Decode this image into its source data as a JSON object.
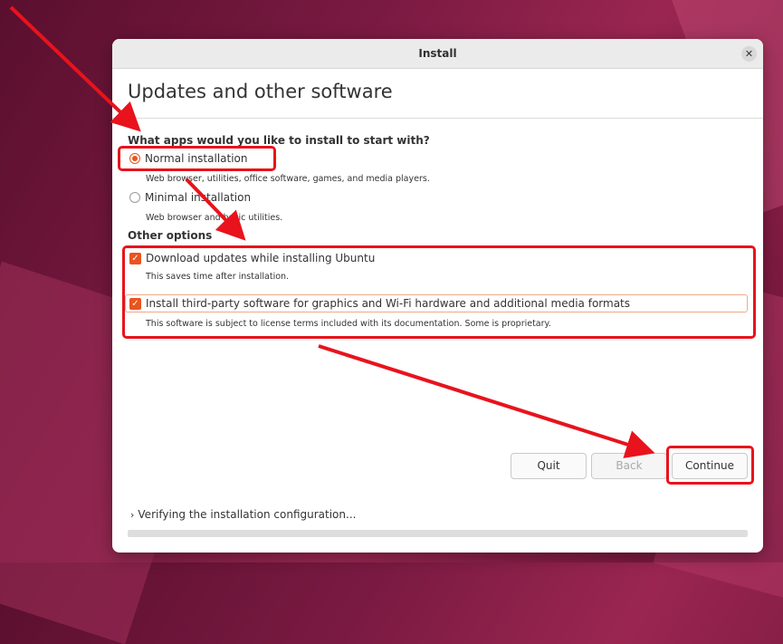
{
  "window": {
    "title": "Install",
    "close_icon": "close-icon",
    "close_glyph": "✕"
  },
  "page": {
    "title": "Updates and other software"
  },
  "install_type": {
    "heading": "What apps would you like to install to start with?",
    "options": [
      {
        "label": "Normal installation",
        "description": "Web browser, utilities, office software, games, and media players.",
        "selected": true
      },
      {
        "label": "Minimal installation",
        "description": "Web browser and basic utilities.",
        "selected": false
      }
    ]
  },
  "other_options": {
    "heading": "Other options",
    "items": [
      {
        "label": "Download updates while installing Ubuntu",
        "description": "This saves time after installation.",
        "checked": true
      },
      {
        "label": "Install third-party software for graphics and Wi-Fi hardware and additional media formats",
        "description": "This software is subject to license terms included with its documentation. Some is proprietary.",
        "checked": true
      }
    ]
  },
  "buttons": {
    "quit": "Quit",
    "back": "Back",
    "continue": "Continue"
  },
  "status": {
    "text": "Verifying the installation configuration...",
    "progress": 0
  },
  "colors": {
    "accent": "#e95420",
    "annotation": "#e8131c"
  }
}
